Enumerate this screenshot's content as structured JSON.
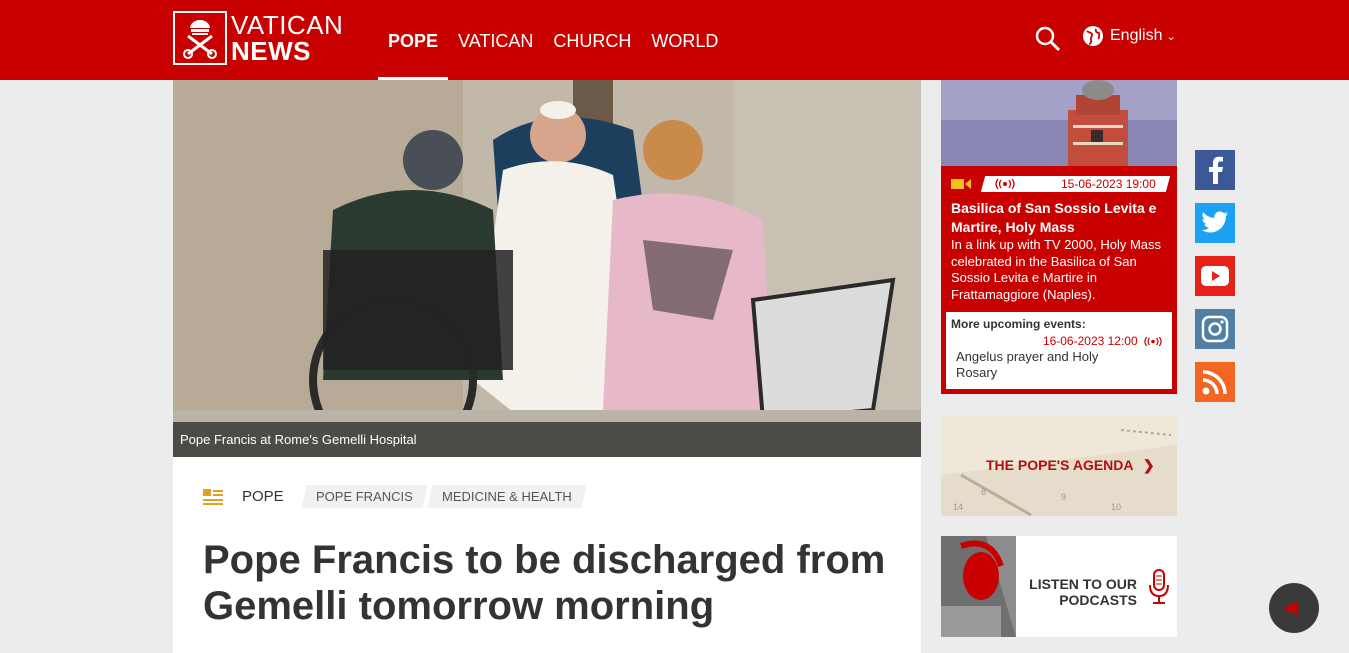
{
  "header": {
    "logo_line1": "VATICAN",
    "logo_line2": "NEWS",
    "nav": [
      {
        "label": "POPE",
        "active": true
      },
      {
        "label": "VATICAN",
        "active": false
      },
      {
        "label": "CHURCH",
        "active": false
      },
      {
        "label": "WORLD",
        "active": false
      }
    ],
    "language": "English",
    "brand_color": "#c90000"
  },
  "hero": {
    "caption": "Pope Francis at Rome's Gemelli Hospital"
  },
  "article": {
    "section": "POPE",
    "tags": [
      "POPE FRANCIS",
      "MEDICINE & HEALTH"
    ],
    "headline": "Pope Francis to be discharged from Gemelli tomorrow morning"
  },
  "event": {
    "datetime": "15-06-2023 19:00",
    "title": "Basilica of San Sossio Levita e Martire, Holy Mass",
    "description": "In a link up with TV 2000, Holy Mass celebrated in the Basilica of San Sossio Levita e Martire in Frattamaggiore (Naples).",
    "more_label": "More upcoming events:",
    "next_datetime": "16-06-2023 12:00",
    "next_title": "Angelus prayer and Holy Rosary"
  },
  "agenda": {
    "label": "THE POPE'S AGENDA"
  },
  "podcasts": {
    "label_line1": "LISTEN TO OUR",
    "label_line2": "PODCASTS"
  },
  "social": [
    {
      "name": "facebook-icon",
      "color": "#3b5998"
    },
    {
      "name": "twitter-icon",
      "color": "#1da1f2"
    },
    {
      "name": "youtube-icon",
      "color": "#e62117"
    },
    {
      "name": "instagram-icon",
      "color": "#517fa4"
    },
    {
      "name": "rss-icon",
      "color": "#f26522"
    }
  ]
}
